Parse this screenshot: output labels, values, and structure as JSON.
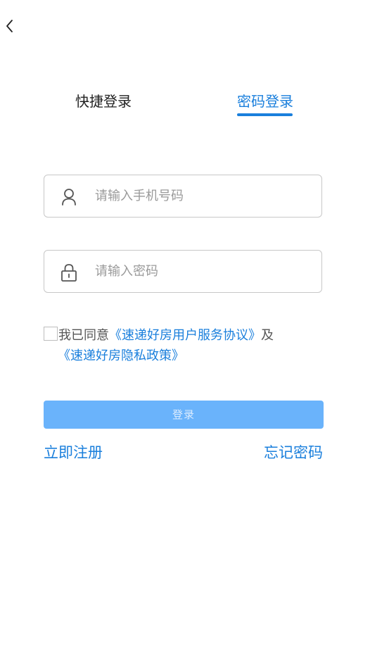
{
  "tabs": {
    "quick_label": "快捷登录",
    "password_label": "密码登录",
    "active": "password"
  },
  "phone_field": {
    "placeholder": "请输入手机号码",
    "value": ""
  },
  "password_field": {
    "placeholder": "请输入密码",
    "value": ""
  },
  "agreement": {
    "checked": false,
    "prefix": "我已同意",
    "service_link": "《速递好房用户服务协议》",
    "conjunction": "及",
    "privacy_link": "《速递好房隐私政策》"
  },
  "login_button": {
    "label": "登录"
  },
  "footer": {
    "register_label": "立即注册",
    "forgot_label": "忘记密码"
  },
  "colors": {
    "accent": "#1a7fdc",
    "button_bg": "#6ab3fb",
    "border": "#c8c8c8"
  },
  "icons": {
    "back": "chevron-left-icon",
    "phone": "user-icon",
    "password": "lock-icon"
  }
}
